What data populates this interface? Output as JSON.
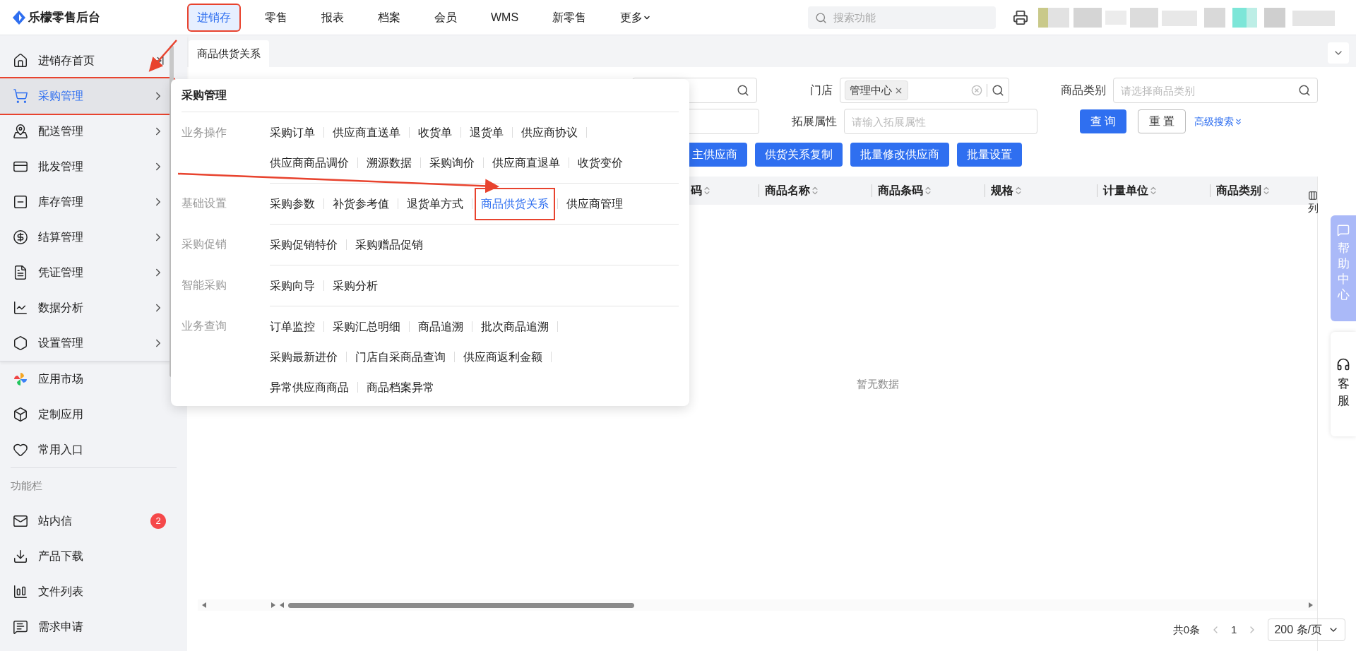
{
  "app": {
    "logo": "乐檬零售后台"
  },
  "top_nav": [
    {
      "label": "进销存",
      "selected": true,
      "highlighted": true
    },
    {
      "label": "零售",
      "selected": false,
      "highlighted": false
    },
    {
      "label": "报表",
      "selected": false,
      "highlighted": false
    },
    {
      "label": "档案",
      "selected": false,
      "highlighted": false
    },
    {
      "label": "会员",
      "selected": false,
      "highlighted": false
    },
    {
      "label": "WMS",
      "selected": false,
      "highlighted": false
    },
    {
      "label": "新零售",
      "selected": false,
      "highlighted": false
    },
    {
      "label": "更多",
      "selected": false,
      "highlighted": false
    }
  ],
  "search": {
    "placeholder": "搜索功能"
  },
  "sidebar": {
    "items": [
      {
        "label": "进销存首页",
        "kind": "home",
        "selected": false,
        "highlighted": false
      },
      {
        "label": "采购管理",
        "kind": "menu",
        "selected": true,
        "highlighted": true
      },
      {
        "label": "配送管理",
        "kind": "menu",
        "selected": false,
        "highlighted": false
      },
      {
        "label": "批发管理",
        "kind": "menu",
        "selected": false,
        "highlighted": false
      },
      {
        "label": "库存管理",
        "kind": "menu",
        "selected": false,
        "highlighted": false
      },
      {
        "label": "结算管理",
        "kind": "menu",
        "selected": false,
        "highlighted": false
      },
      {
        "label": "凭证管理",
        "kind": "menu",
        "selected": false,
        "highlighted": false
      },
      {
        "label": "数据分析",
        "kind": "menu",
        "selected": false,
        "highlighted": false
      },
      {
        "label": "设置管理",
        "kind": "menu",
        "selected": false,
        "highlighted": false
      }
    ],
    "apps": [
      {
        "label": "应用市场"
      },
      {
        "label": "定制应用"
      },
      {
        "label": "常用入口"
      }
    ],
    "tools_title": "功能栏",
    "tools": [
      {
        "label": "站内信",
        "badge": "2"
      },
      {
        "label": "产品下载"
      },
      {
        "label": "文件列表"
      },
      {
        "label": "需求申请"
      }
    ]
  },
  "tabs": [
    {
      "label": "商品供货关系",
      "selected": true
    }
  ],
  "filters": {
    "store_label": "门店",
    "store_tag": "管理中心",
    "category_label": "商品类别",
    "category_placeholder": "请选择商品类别",
    "ext_label": "拓展属性",
    "ext_placeholder": "请输入拓展属性",
    "query": "查 询",
    "reset": "重 置",
    "advanced": "高级搜索"
  },
  "actions": [
    "主供应商",
    "供货关系复制",
    "批量修改供应商",
    "批量设置"
  ],
  "table": {
    "columns": [
      "码",
      "商品名称",
      "商品条码",
      "规格",
      "计量单位",
      "商品类别"
    ],
    "column_settings": "列",
    "empty_text": "暂无数据"
  },
  "pagination": {
    "total": "共0条",
    "page": "1",
    "page_size": "200 条/页"
  },
  "flyout": {
    "title": "采购管理",
    "groups": [
      {
        "label": "业务操作",
        "lines": [
          {
            "items": [
              {
                "label": "采购订单",
                "selected": false,
                "highlighted": false
              },
              {
                "label": "供应商直送单",
                "selected": false,
                "highlighted": false
              },
              {
                "label": "收货单",
                "selected": false,
                "highlighted": false
              },
              {
                "label": "退货单",
                "selected": false,
                "highlighted": false
              },
              {
                "label": "供应商协议",
                "selected": false,
                "highlighted": false
              }
            ]
          },
          {
            "items": [
              {
                "label": "供应商商品调价",
                "selected": false,
                "highlighted": false
              },
              {
                "label": "溯源数据",
                "selected": false,
                "highlighted": false
              },
              {
                "label": "采购询价",
                "selected": false,
                "highlighted": false
              },
              {
                "label": "供应商直退单",
                "selected": false,
                "highlighted": false
              },
              {
                "label": "收货变价",
                "selected": false,
                "highlighted": false
              }
            ]
          }
        ]
      },
      {
        "label": "基础设置",
        "lines": [
          {
            "items": [
              {
                "label": "采购参数",
                "selected": false,
                "highlighted": false
              },
              {
                "label": "补货参考值",
                "selected": false,
                "highlighted": false
              },
              {
                "label": "退货单方式",
                "selected": false,
                "highlighted": false
              },
              {
                "label": "商品供货关系",
                "selected": true,
                "highlighted": true
              },
              {
                "label": "供应商管理",
                "selected": false,
                "highlighted": false
              }
            ]
          }
        ]
      },
      {
        "label": "采购促销",
        "lines": [
          {
            "items": [
              {
                "label": "采购促销特价",
                "selected": false,
                "highlighted": false
              },
              {
                "label": "采购赠品促销",
                "selected": false,
                "highlighted": false
              }
            ]
          }
        ]
      },
      {
        "label": "智能采购",
        "lines": [
          {
            "items": [
              {
                "label": "采购向导",
                "selected": false,
                "highlighted": false
              },
              {
                "label": "采购分析",
                "selected": false,
                "highlighted": false
              }
            ]
          }
        ]
      },
      {
        "label": "业务查询",
        "lines": [
          {
            "items": [
              {
                "label": "订单监控",
                "selected": false,
                "highlighted": false
              },
              {
                "label": "采购汇总明细",
                "selected": false,
                "highlighted": false
              },
              {
                "label": "商品追溯",
                "selected": false,
                "highlighted": false
              },
              {
                "label": "批次商品追溯",
                "selected": false,
                "highlighted": false
              }
            ]
          },
          {
            "items": [
              {
                "label": "采购最新进价",
                "selected": false,
                "highlighted": false
              },
              {
                "label": "门店自采商品查询",
                "selected": false,
                "highlighted": false
              },
              {
                "label": "供应商返利金额",
                "selected": false,
                "highlighted": false
              }
            ]
          },
          {
            "items": [
              {
                "label": "异常供应商商品",
                "selected": false,
                "highlighted": false
              },
              {
                "label": "商品档案异常",
                "selected": false,
                "highlighted": false
              }
            ]
          }
        ]
      }
    ]
  },
  "help": {
    "help_center": "帮助中心",
    "support": "客服"
  }
}
